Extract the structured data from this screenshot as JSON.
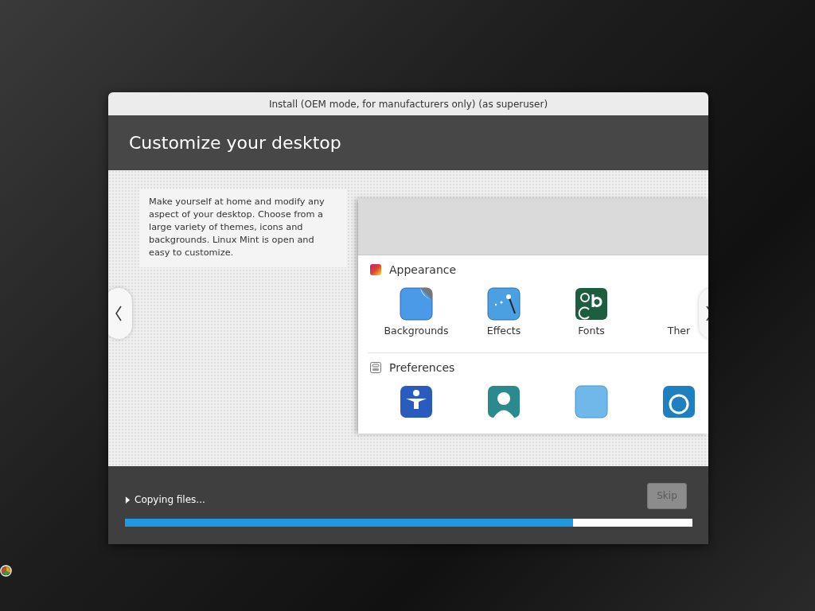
{
  "window": {
    "title": "Install (OEM mode, for manufacturers only) (as superuser)"
  },
  "header": {
    "title": "Customize your desktop"
  },
  "slide": {
    "description": "Make yourself at home and modify any aspect of your desktop. Choose from a large variety of themes, icons and backgrounds. Linux Mint is open and easy to customize.",
    "sections": [
      {
        "title": "Appearance",
        "items": [
          {
            "label": "Backgrounds"
          },
          {
            "label": "Effects"
          },
          {
            "label": "Fonts"
          },
          {
            "label": "Ther"
          }
        ]
      },
      {
        "title": "Preferences"
      }
    ]
  },
  "footer": {
    "status": "Copying files...",
    "expanded": false,
    "progress": {
      "level": 0.79
    },
    "skip": {
      "label": "Skip",
      "disabled": true
    }
  }
}
